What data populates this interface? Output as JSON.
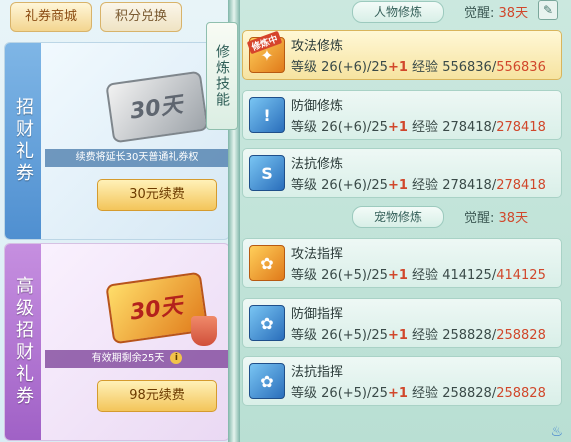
{
  "tabs": {
    "voucher_shop": "礼券商城",
    "points_exchange": "积分兑换"
  },
  "cards": [
    {
      "title": "招财礼券",
      "ticket_label": "30天",
      "note": "续费将延长30天普通礼券权",
      "renew_button": "30元续费"
    },
    {
      "title": "高级招财礼券",
      "ticket_label": "30天",
      "note": "有效期剩余25天",
      "renew_button": "98元续费"
    }
  ],
  "cultivation_label": "修炼技能",
  "character_section": {
    "title": "人物修炼",
    "awaken_label": "觉醒:",
    "awaken_value": "38天",
    "rows": [
      {
        "name": "攻法修炼",
        "level_label": "等级",
        "level": "26(+6)/25",
        "plus": "+1",
        "exp_label": "经验",
        "exp_cur": "556836",
        "exp_max": "556836",
        "badge": "修炼中",
        "icon": "attack-magic-icon",
        "icon_glyph": "✦",
        "icon_color": "orange"
      },
      {
        "name": "防御修炼",
        "level_label": "等级",
        "level": "26(+6)/25",
        "plus": "+1",
        "exp_label": "经验",
        "exp_cur": "278418",
        "exp_max": "278418",
        "icon": "defense-shield-icon",
        "icon_glyph": "!",
        "icon_color": "blue"
      },
      {
        "name": "法抗修炼",
        "level_label": "等级",
        "level": "26(+6)/25",
        "plus": "+1",
        "exp_label": "经验",
        "exp_cur": "278418",
        "exp_max": "278418",
        "icon": "magic-resist-icon",
        "icon_glyph": "S",
        "icon_color": "blue"
      }
    ]
  },
  "pet_section": {
    "title": "宠物修炼",
    "awaken_label": "觉醒:",
    "awaken_value": "38天",
    "rows": [
      {
        "name": "攻法指挥",
        "level_label": "等级",
        "level": "26(+5)/25",
        "plus": "+1",
        "exp_label": "经验",
        "exp_cur": "414125",
        "exp_max": "414125",
        "icon": "paw-attack-icon",
        "icon_glyph": "✿",
        "icon_color": "orange"
      },
      {
        "name": "防御指挥",
        "level_label": "等级",
        "level": "26(+5)/25",
        "plus": "+1",
        "exp_label": "经验",
        "exp_cur": "258828",
        "exp_max": "258828",
        "icon": "paw-defense-icon",
        "icon_glyph": "✿",
        "icon_color": "blue"
      },
      {
        "name": "法抗指挥",
        "level_label": "等级",
        "level": "26(+5)/25",
        "plus": "+1",
        "exp_label": "经验",
        "exp_cur": "258828",
        "exp_max": "258828",
        "icon": "paw-resist-icon",
        "icon_glyph": "✿",
        "icon_color": "blue"
      }
    ]
  }
}
